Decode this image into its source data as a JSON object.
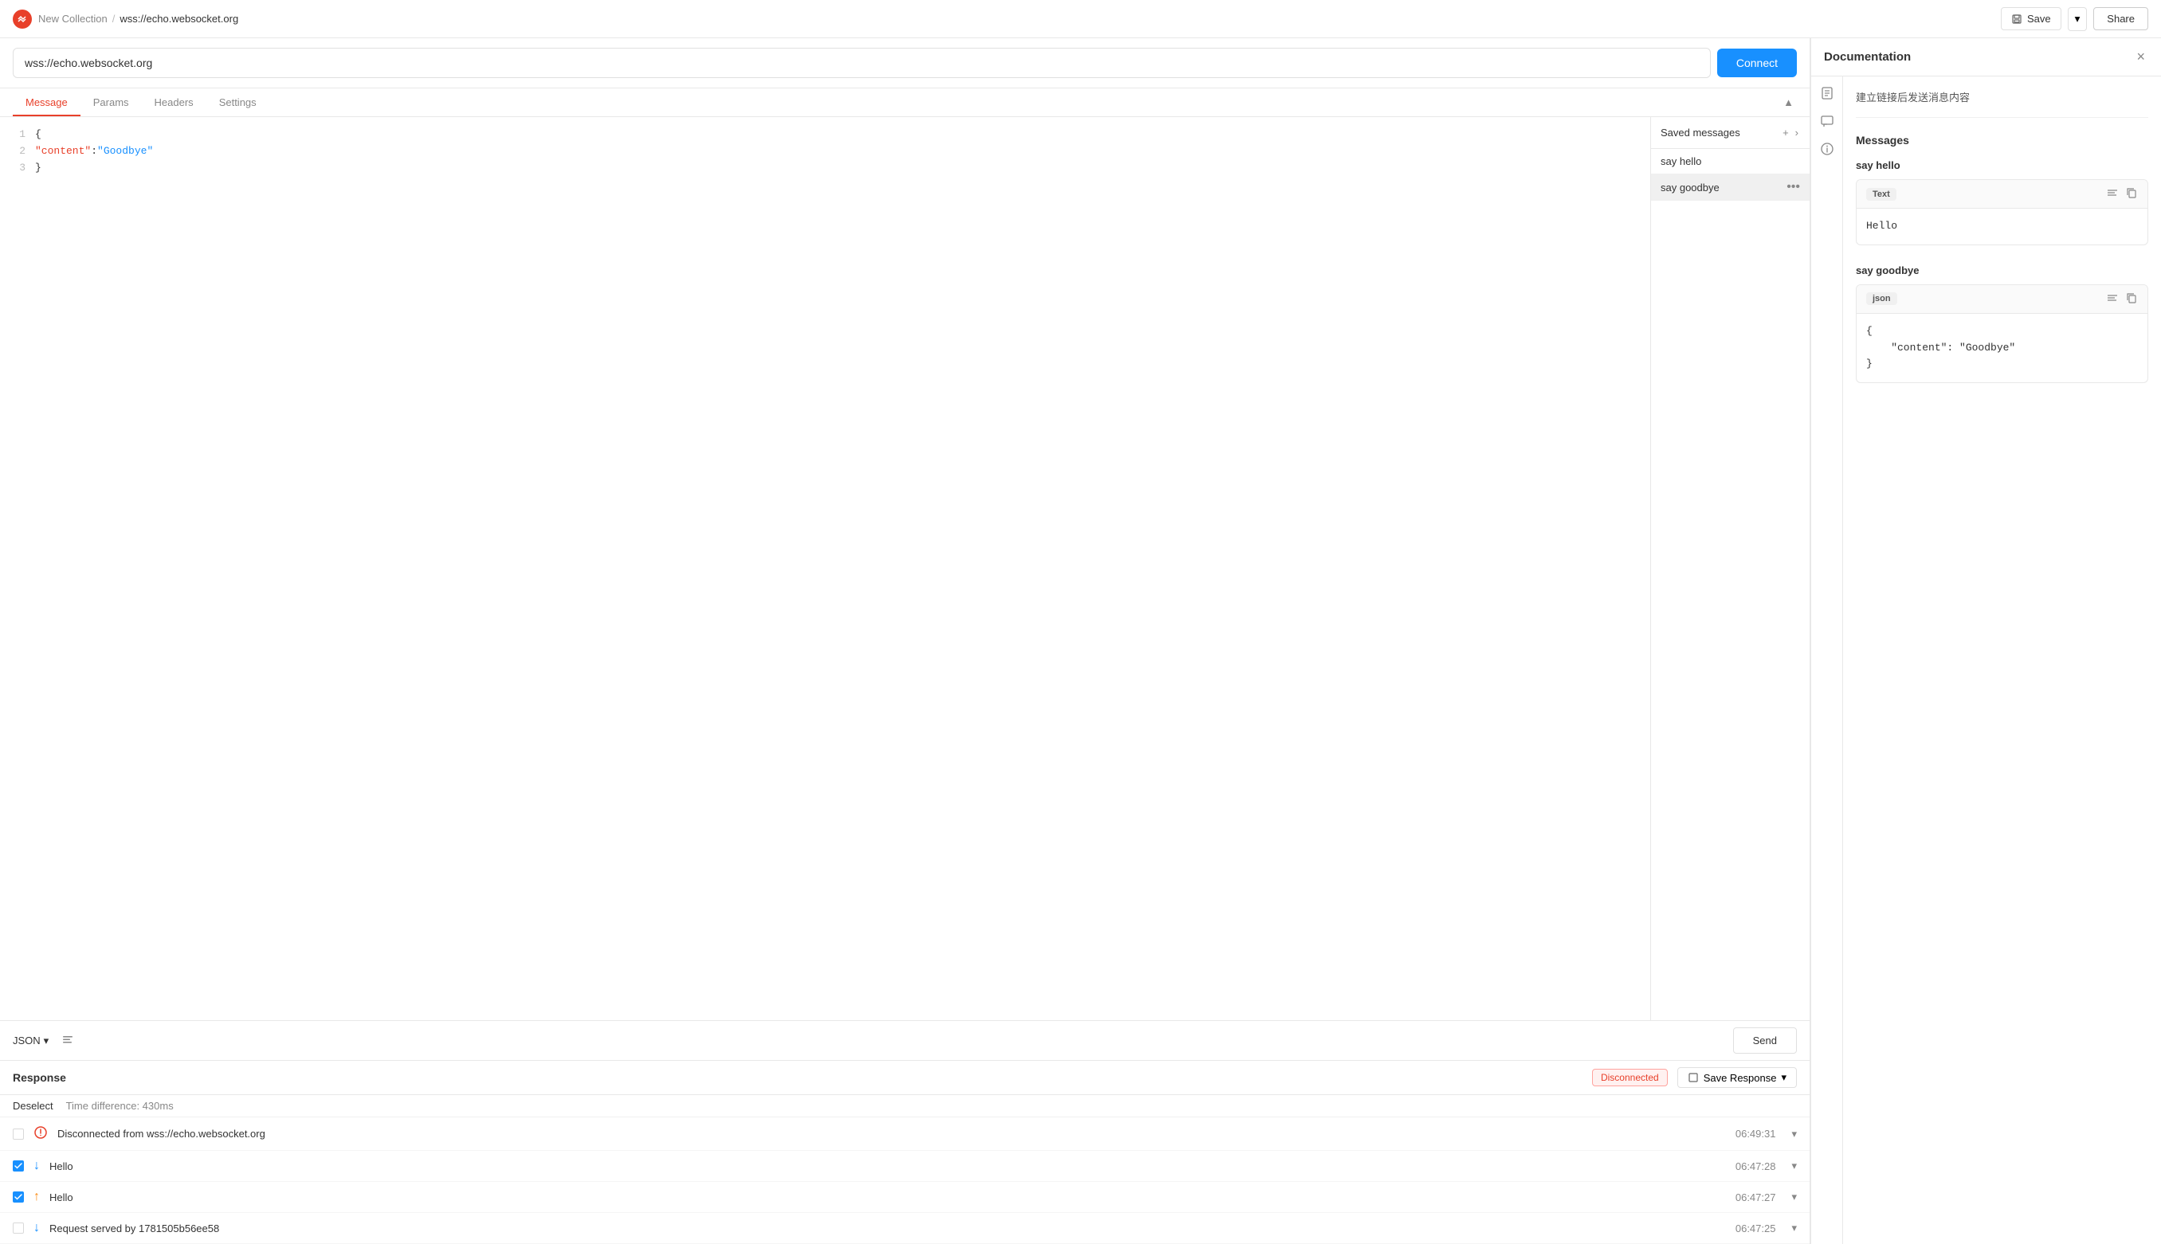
{
  "topbar": {
    "collection": "New Collection",
    "separator": "/",
    "current": "wss://echo.websocket.org",
    "save_label": "Save",
    "share_label": "Share"
  },
  "url_bar": {
    "url": "wss://echo.websocket.org",
    "connect_label": "Connect"
  },
  "tabs": {
    "items": [
      "Message",
      "Params",
      "Headers",
      "Settings"
    ],
    "active": "Message"
  },
  "editor": {
    "lines": [
      {
        "num": "1",
        "content": "{",
        "type": "bracket"
      },
      {
        "num": "2",
        "content_key": "\"content\"",
        "content_colon": ":",
        "content_val": "\"Goodbye\"",
        "type": "kv"
      },
      {
        "num": "3",
        "content": "}",
        "type": "bracket"
      }
    ]
  },
  "saved_messages": {
    "title": "Saved messages",
    "items": [
      {
        "label": "say hello",
        "active": false
      },
      {
        "label": "say goodbye",
        "active": true
      }
    ]
  },
  "bottom_bar": {
    "format": "JSON",
    "send_label": "Send"
  },
  "response": {
    "title": "Response",
    "status": "Disconnected",
    "save_response_label": "Save Response",
    "deselect_label": "Deselect",
    "time_diff": "Time difference: 430ms",
    "items": [
      {
        "type": "error",
        "icon": "⊙",
        "text": "Disconnected from wss://echo.websocket.org",
        "time": "06:49:31",
        "checked": false,
        "arrow": "down"
      },
      {
        "type": "received",
        "text": "Hello",
        "time": "06:47:28",
        "checked": true,
        "arrow": "down"
      },
      {
        "type": "sent",
        "text": "Hello",
        "time": "06:47:27",
        "checked": true,
        "arrow": "up"
      },
      {
        "type": "received",
        "text": "Request served by 1781505b56ee58",
        "time": "06:47:25",
        "checked": false,
        "arrow": "down"
      }
    ]
  },
  "documentation": {
    "title": "Documentation",
    "close_label": "×",
    "description": "建立链接后发送消息内容",
    "messages_title": "Messages",
    "groups": [
      {
        "title": "say hello",
        "badge": "Text",
        "badge_type": "text",
        "body": "Hello"
      },
      {
        "title": "say goodbye",
        "badge": "json",
        "badge_type": "json",
        "body": "{\n    \"content\": \"Goodbye\"\n}"
      }
    ]
  }
}
